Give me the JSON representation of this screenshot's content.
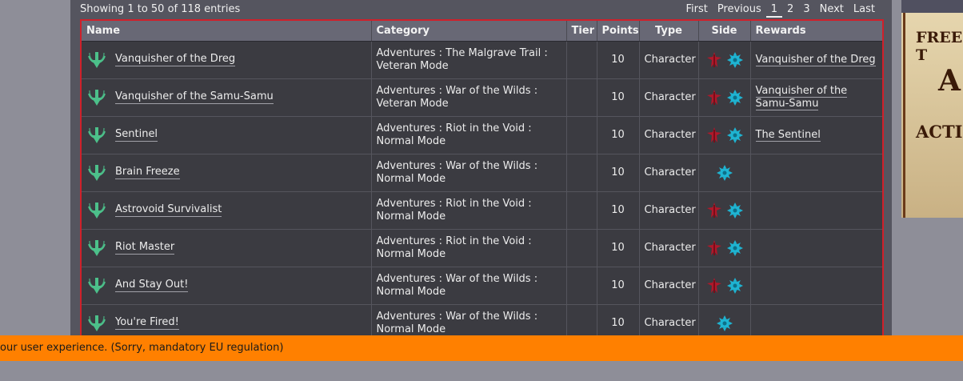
{
  "pagination": {
    "info": "Showing 1 to 50 of 118 entries",
    "first": "First",
    "previous": "Previous",
    "pages": [
      "1",
      "2",
      "3"
    ],
    "current_page": "1",
    "next": "Next",
    "last": "Last"
  },
  "table": {
    "headers": {
      "name": "Name",
      "category": "Category",
      "tier": "Tier",
      "points": "Points",
      "type": "Type",
      "side": "Side",
      "rewards": "Rewards"
    },
    "rows": [
      {
        "name": "Vanquisher of the Dreg",
        "category": "Adventures : The Malgrave Trail : Veteran Mode",
        "tier": "",
        "points": "10",
        "type": "Character",
        "sides": [
          "empire-icon",
          "republic-icon"
        ],
        "reward": "Vanquisher of the Dreg"
      },
      {
        "name": "Vanquisher of the Samu-Samu",
        "category": "Adventures : War of the Wilds : Veteran Mode",
        "tier": "",
        "points": "10",
        "type": "Character",
        "sides": [
          "empire-icon",
          "republic-icon"
        ],
        "reward": "Vanquisher of the Samu-Samu"
      },
      {
        "name": "Sentinel",
        "category": "Adventures : Riot in the Void : Normal Mode",
        "tier": "",
        "points": "10",
        "type": "Character",
        "sides": [
          "empire-icon",
          "republic-icon"
        ],
        "reward": "The Sentinel"
      },
      {
        "name": "Brain Freeze",
        "category": "Adventures : War of the Wilds : Normal Mode",
        "tier": "",
        "points": "10",
        "type": "Character",
        "sides": [
          "republic-icon"
        ],
        "reward": ""
      },
      {
        "name": "Astrovoid Survivalist",
        "category": "Adventures : Riot in the Void : Normal Mode",
        "tier": "",
        "points": "10",
        "type": "Character",
        "sides": [
          "empire-icon",
          "republic-icon"
        ],
        "reward": ""
      },
      {
        "name": "Riot Master",
        "category": "Adventures : Riot in the Void : Normal Mode",
        "tier": "",
        "points": "10",
        "type": "Character",
        "sides": [
          "empire-icon",
          "republic-icon"
        ],
        "reward": ""
      },
      {
        "name": "And Stay Out!",
        "category": "Adventures : War of the Wilds : Normal Mode",
        "tier": "",
        "points": "10",
        "type": "Character",
        "sides": [
          "empire-icon",
          "republic-icon"
        ],
        "reward": ""
      },
      {
        "name": "You're Fired!",
        "category": "Adventures : War of the Wilds : Normal Mode",
        "tier": "",
        "points": "10",
        "type": "Character",
        "sides": [
          "republic-icon"
        ],
        "reward": ""
      }
    ]
  },
  "cookie_bar": {
    "text": "our user experience. (Sorry, mandatory EU regulation)"
  },
  "ad": {
    "line1": "FREE T",
    "line2": "A",
    "line3": "ACTIO"
  },
  "colors": {
    "highlight_border": "#d0202a",
    "cookie_bar": "#ff8000",
    "empire": "#b0182a",
    "republic": "#1eb4d2",
    "achievement_icon": "#4cc08a"
  }
}
